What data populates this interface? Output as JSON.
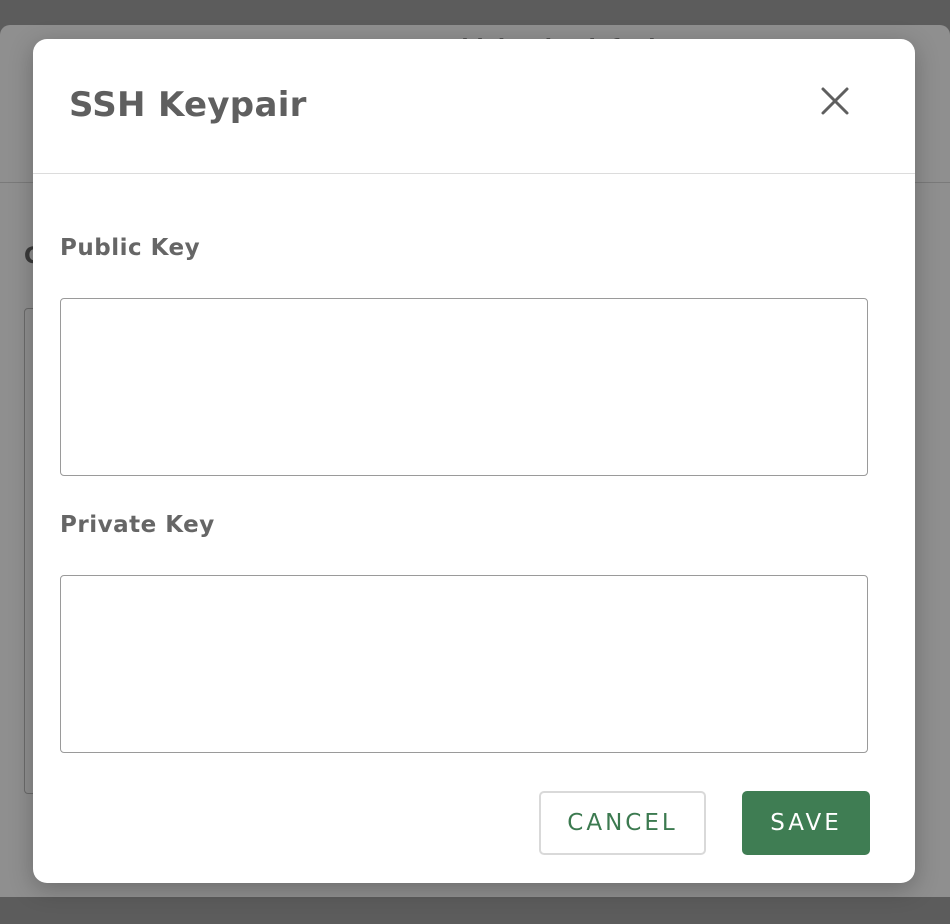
{
  "background": {
    "header_text": "Use Compact Sidebar by default",
    "section_letter": "C"
  },
  "modal": {
    "title": "SSH Keypair",
    "close_icon": "close-icon",
    "fields": {
      "public_key": {
        "label": "Public Key",
        "value": "",
        "placeholder": ""
      },
      "private_key": {
        "label": "Private Key",
        "value": "",
        "placeholder": ""
      }
    },
    "actions": {
      "cancel_label": "CANCEL",
      "save_label": "SAVE"
    }
  },
  "colors": {
    "accent": "#3f7d53",
    "accent_text": "#3c7a50",
    "overlay": "#8f8f8f"
  }
}
